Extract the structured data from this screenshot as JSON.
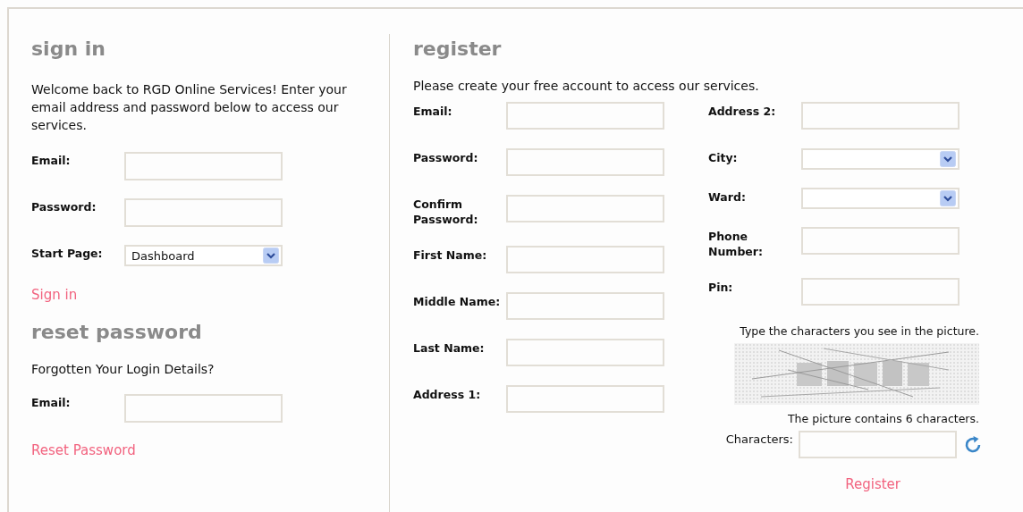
{
  "sign_in": {
    "title": "sign in",
    "intro": "Welcome back to RGD Online Services! Enter your email address and password below to access our services.",
    "fields": [
      {
        "label": "Email:",
        "kind": "text"
      },
      {
        "label": "Password:",
        "kind": "text"
      },
      {
        "label": "Start Page:",
        "kind": "select",
        "value": "Dashboard"
      }
    ],
    "link": "Sign in"
  },
  "reset_password": {
    "title": "reset password",
    "prompt": "Forgotten Your Login Details?",
    "fields": [
      {
        "label": "Email:",
        "kind": "text"
      }
    ],
    "link": "Reset Password"
  },
  "register": {
    "title": "register",
    "intro": "Please create your free account to access our services.",
    "columns": [
      [
        {
          "label": "Email:",
          "kind": "text"
        },
        {
          "label": "Password:",
          "kind": "text"
        },
        {
          "label": "Confirm Password:",
          "kind": "text"
        },
        {
          "label": "First Name:",
          "kind": "text"
        },
        {
          "label": "Middle Name:",
          "kind": "text"
        },
        {
          "label": "Last Name:",
          "kind": "text"
        },
        {
          "label": "Address 1:",
          "kind": "text"
        }
      ],
      [
        {
          "label": "Address 2:",
          "kind": "text"
        },
        {
          "label": "City:",
          "kind": "select"
        },
        {
          "label": "Ward:",
          "kind": "select"
        },
        {
          "label": "Phone Number:",
          "kind": "text"
        },
        {
          "label": "Pin:",
          "kind": "text"
        }
      ]
    ],
    "captcha": {
      "instruction": "Type the characters you see in the picture.",
      "note": "The picture contains 6 characters.",
      "label": "Characters:"
    },
    "link": "Register"
  }
}
